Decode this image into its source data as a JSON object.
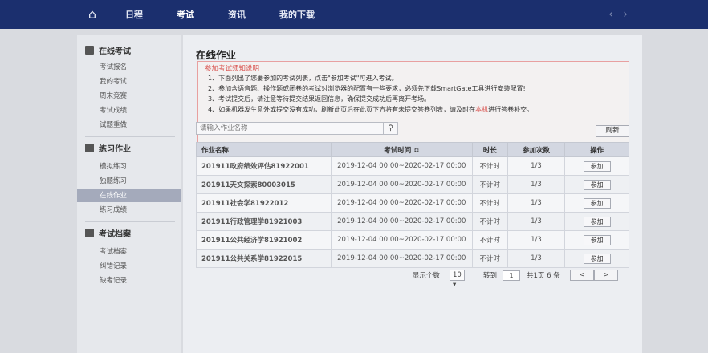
{
  "nav": {
    "home_icon": "home-icon",
    "items": [
      "日程",
      "考试",
      "资讯",
      "我的下载"
    ],
    "active_index": 1,
    "prev_icon": "chevron-left-icon",
    "next_icon": "chevron-right-icon"
  },
  "sidebar": {
    "groups": [
      {
        "title": "在线考试",
        "icon": "exam-icon",
        "items": [
          "考试报名",
          "我的考试",
          "周末竞赛",
          "考试成绩",
          "试题重做"
        ]
      },
      {
        "title": "练习作业",
        "icon": "practice-icon",
        "items": [
          "模拟练习",
          "独题练习",
          "在线作业",
          "练习成绩"
        ]
      },
      {
        "title": "考试档案",
        "icon": "archive-icon",
        "items": [
          "考试档案",
          "纠错记录",
          "缺考记录"
        ]
      }
    ],
    "active_item": "在线作业"
  },
  "main": {
    "title": "在线作业",
    "notice": {
      "heading": "参加考试须知说明",
      "lines": [
        "1、下面列出了您要参加的考试列表，点击\"参加考试\"可进入考试。",
        "2、参加含语音题、操作题或闭卷的考试对浏览器的配置有一些要求，必须先下载SmartGate工具进行安装配置!",
        "3、考试提交后，请注意等待提交结果返回信息，确保提交成功后再离开考场。",
        "4、如果机器发生意外或提交没有成功，刷新此页后在此页下方将有未提交答卷列表，请及时在"
      ],
      "line4_highlight": "本机",
      "line4_tail": "进行答卷补交。"
    },
    "search": {
      "placeholder": "请输入作业名称",
      "icon": "search-icon"
    },
    "refresh_label": "刷新",
    "table": {
      "headers": [
        "作业名称",
        "考试时间 ≎",
        "时长",
        "参加次数",
        "操作"
      ],
      "rows": [
        {
          "name": "201911政府绩效评估81922001",
          "time": "2019-12-04 00:00~2020-02-17 00:00",
          "duration": "不计时",
          "count": "1/3",
          "action": "参加"
        },
        {
          "name": "201911天文探索80003015",
          "time": "2019-12-04 00:00~2020-02-17 00:00",
          "duration": "不计时",
          "count": "1/3",
          "action": "参加"
        },
        {
          "name": "201911社会学81922012",
          "time": "2019-12-04 00:00~2020-02-17 00:00",
          "duration": "不计时",
          "count": "1/3",
          "action": "参加"
        },
        {
          "name": "201911行政管理学81921003",
          "time": "2019-12-04 00:00~2020-02-17 00:00",
          "duration": "不计时",
          "count": "1/3",
          "action": "参加"
        },
        {
          "name": "201911公共经济学81921002",
          "time": "2019-12-04 00:00~2020-02-17 00:00",
          "duration": "不计时",
          "count": "1/3",
          "action": "参加"
        },
        {
          "name": "201911公共关系学81922015",
          "time": "2019-12-04 00:00~2020-02-17 00:00",
          "duration": "不计时",
          "count": "1/3",
          "action": "参加"
        }
      ]
    },
    "pager": {
      "size_label": "显示个数",
      "size_value": "10 ▾",
      "goto_label": "转到",
      "goto_value": "1",
      "summary": "共1页 6 条",
      "prev": "<",
      "next": ">"
    }
  }
}
